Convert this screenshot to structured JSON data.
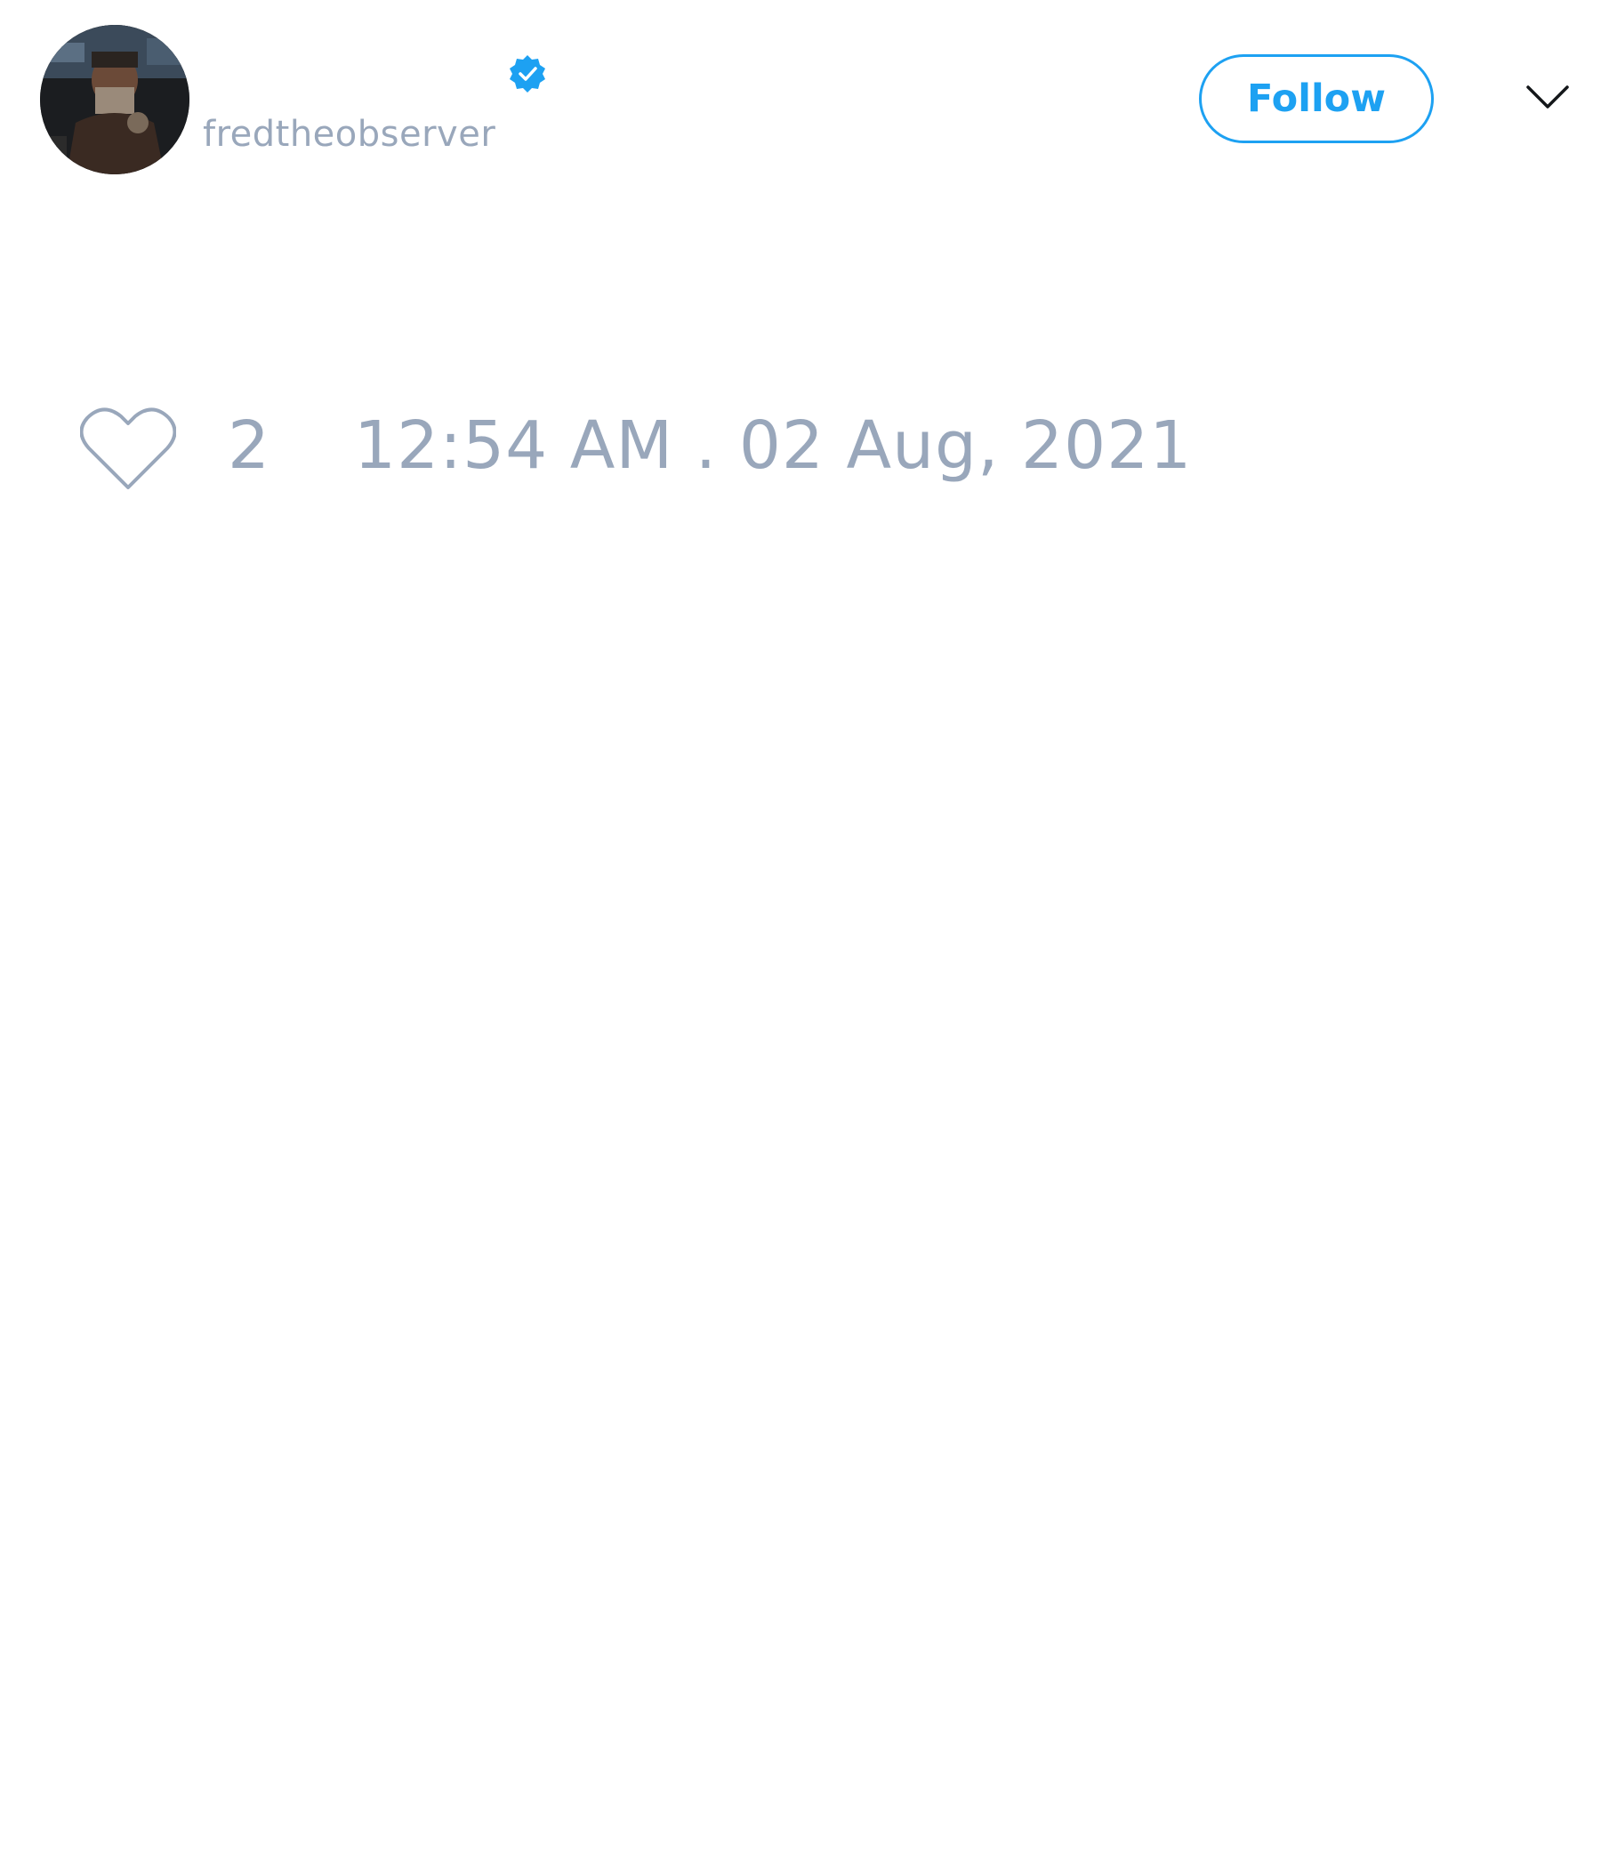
{
  "tweet": {
    "author": {
      "handle": "fredtheobserver",
      "verified": true
    },
    "header": {
      "follow_label": "Follow"
    },
    "footer": {
      "like_count": "2",
      "timestamp": "12:54 AM . 02 Aug, 2021"
    }
  },
  "icons": {
    "avatar": "avatar-photo",
    "verified": "verified-badge-icon",
    "like": "heart-icon",
    "menu": "chevron-down-icon"
  },
  "colors": {
    "accent": "#1da1f2",
    "muted_text": "#99a7bb",
    "background": "#ffffff"
  }
}
